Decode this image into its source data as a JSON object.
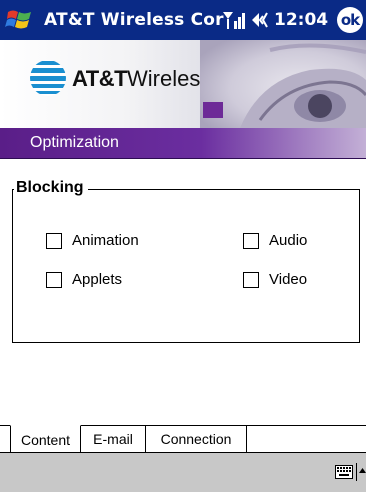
{
  "titlebar": {
    "app_title": "AT&T Wireless Cor",
    "clock": "12:04",
    "ok_label": "ok"
  },
  "banner": {
    "logo_brand": "AT&T",
    "logo_suffix": "Wireless"
  },
  "section": {
    "title": "Optimization"
  },
  "blocking": {
    "legend": "Blocking",
    "options": [
      {
        "label": "Animation",
        "checked": false
      },
      {
        "label": "Audio",
        "checked": false
      },
      {
        "label": "Applets",
        "checked": false
      },
      {
        "label": "Video",
        "checked": false
      }
    ]
  },
  "tabs": [
    {
      "label": "Content",
      "selected": true
    },
    {
      "label": "E-mail",
      "selected": false
    },
    {
      "label": "Connection",
      "selected": false
    }
  ],
  "colors": {
    "titlebar": "#0a2a86",
    "section_band": "#5a1e88",
    "accent_square": "#6d2a97",
    "bottom_bar": "#c8c8c8"
  }
}
